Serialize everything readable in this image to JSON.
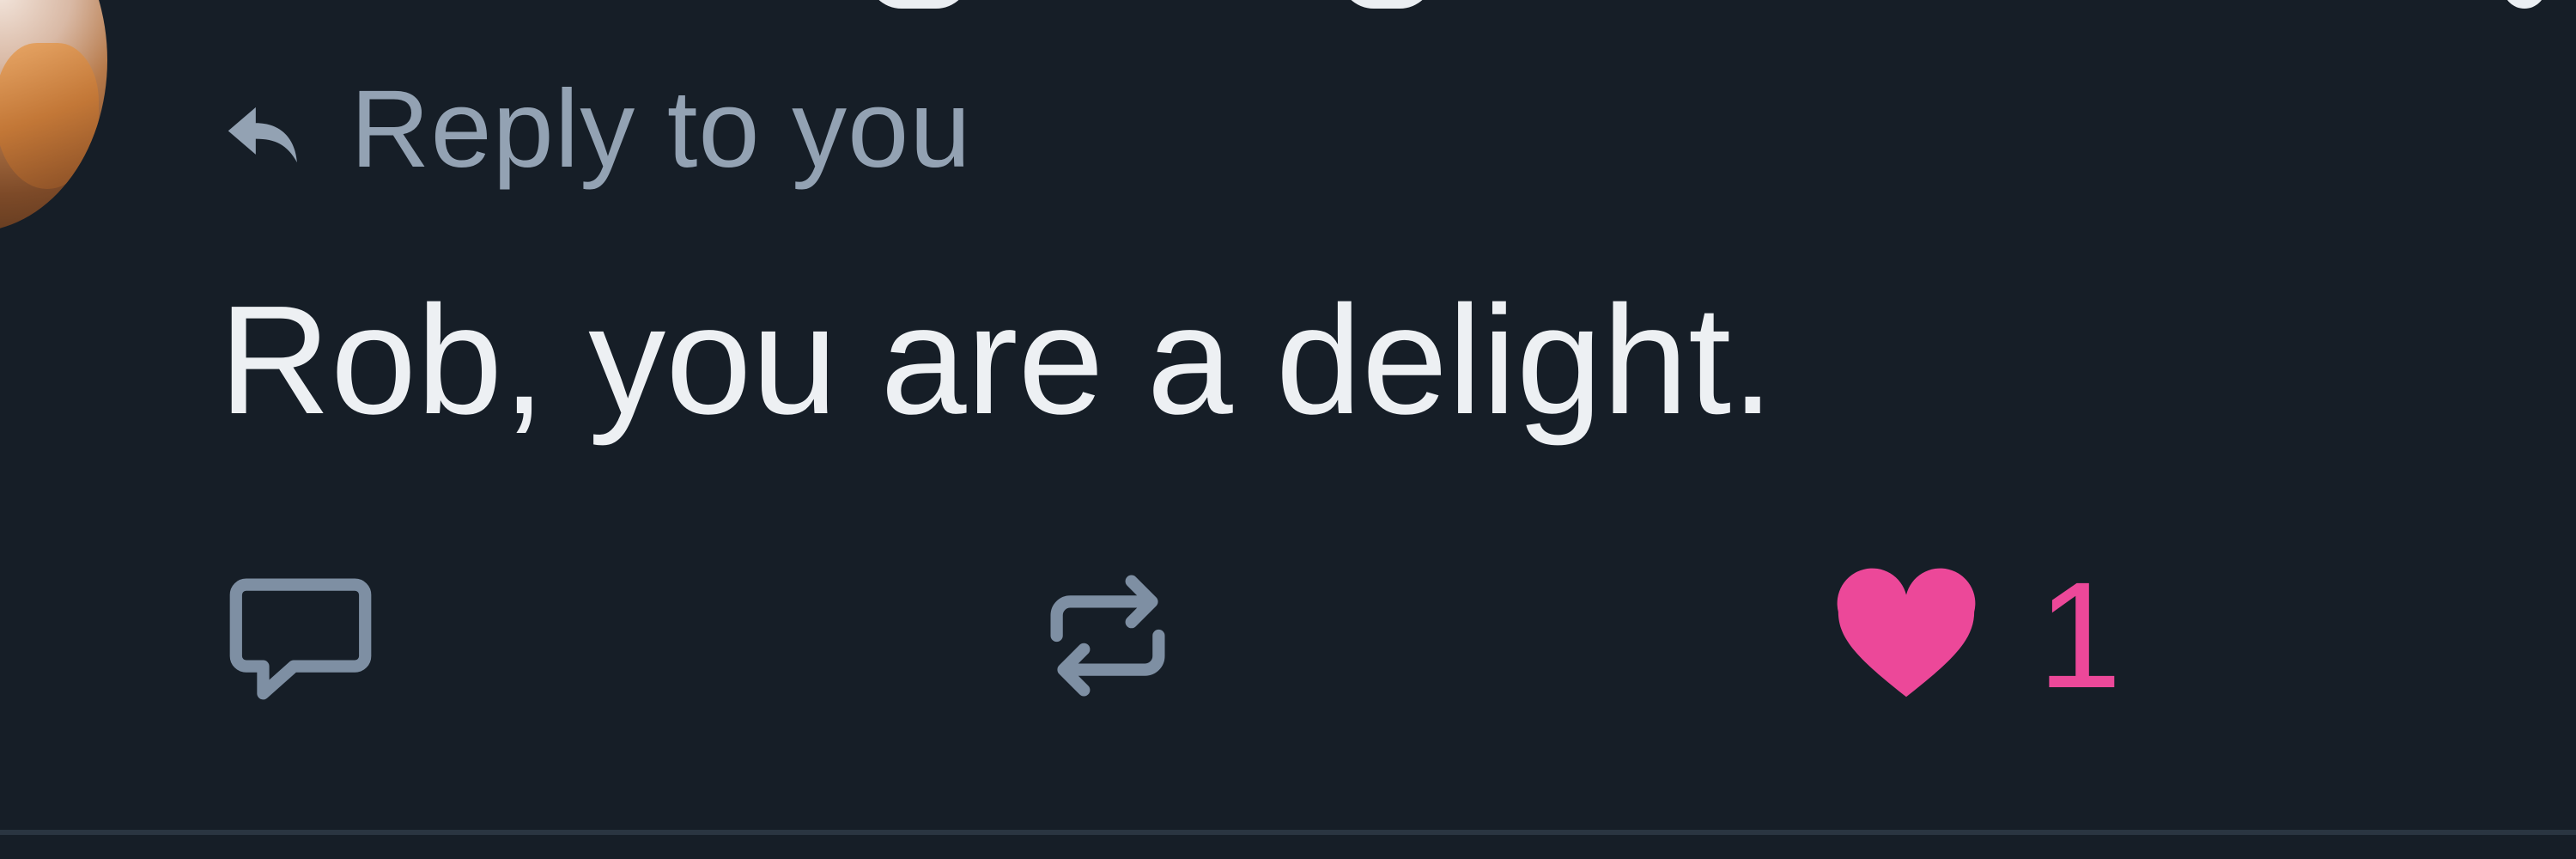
{
  "post": {
    "reply_label": "Reply to you",
    "text": "Rob, you are a delight.",
    "like_count": "1"
  },
  "icons": {
    "reply_context": "reply-arrow-icon",
    "reply_action": "speech-bubble-icon",
    "repost_action": "repost-icon",
    "like_action": "heart-icon"
  },
  "colors": {
    "background": "#161e27",
    "muted_text": "#93a2b3",
    "body_text": "#edf0f3",
    "like": "#ec4899",
    "divider": "#2a3541"
  }
}
